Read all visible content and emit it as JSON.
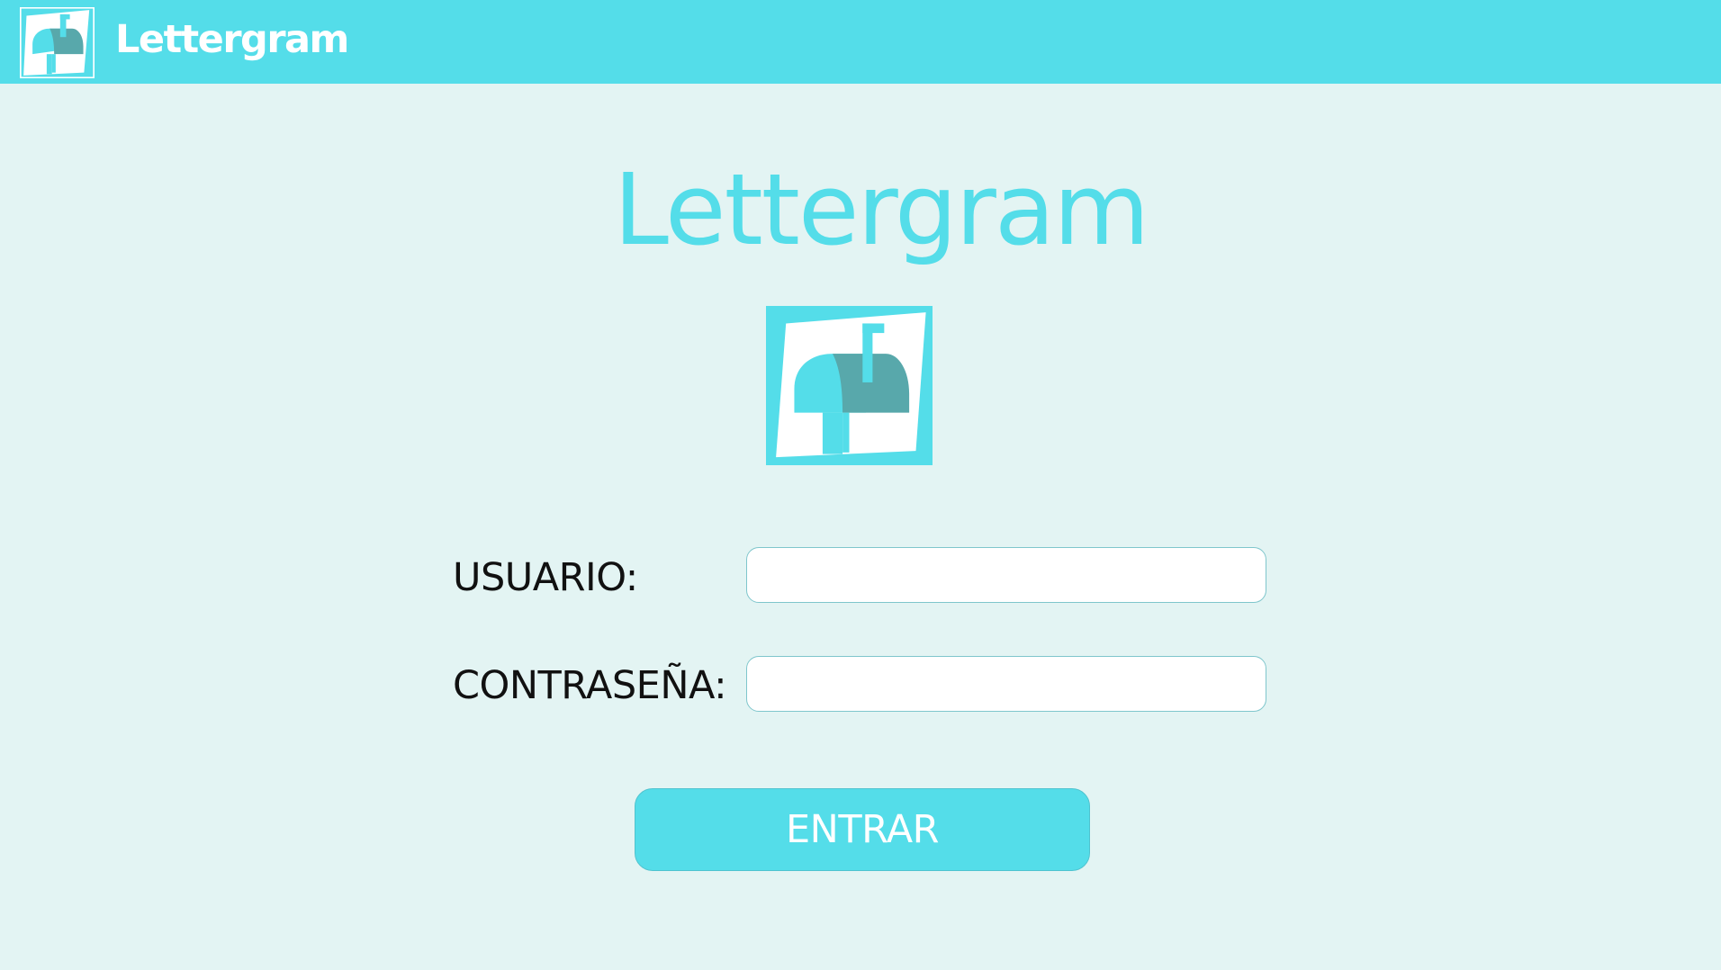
{
  "app": {
    "title": "Lettergram"
  },
  "header": {
    "logo_icon": "mailbox-icon",
    "title": "Lettergram"
  },
  "login": {
    "heading": "Lettergram",
    "logo_icon": "mailbox-icon",
    "username_label": "USUARIO:",
    "username_value": "",
    "password_label": "CONTRASEÑA:",
    "password_value": "",
    "submit_label": "ENTRAR"
  },
  "colors": {
    "accent": "#54dde9",
    "background": "#e3f4f3",
    "mailbox_shadow": "#58a8ab",
    "label_text": "#111111"
  }
}
